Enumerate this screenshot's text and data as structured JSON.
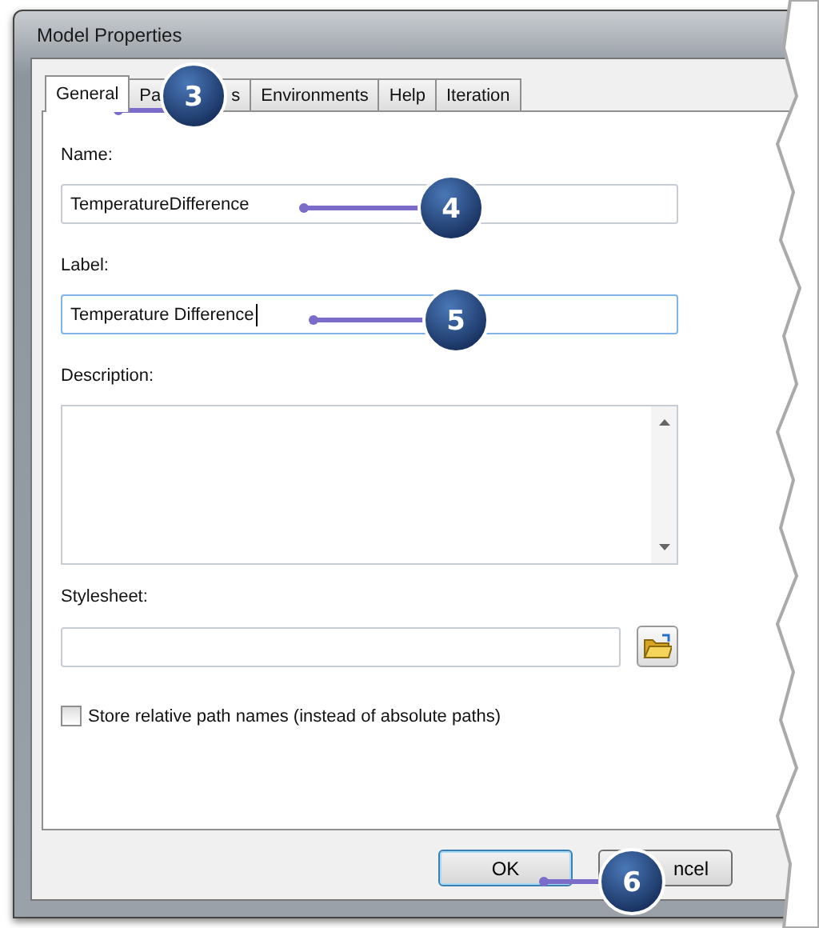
{
  "window": {
    "title": "Model Properties"
  },
  "tabs": [
    {
      "label": "General",
      "selected": true
    },
    {
      "label_start": "Pa",
      "label_end": "s",
      "selected": false
    },
    {
      "label": "Environments",
      "selected": false
    },
    {
      "label": "Help",
      "selected": false
    },
    {
      "label": "Iteration",
      "selected": false
    }
  ],
  "fields": [
    {
      "kind": "text",
      "label": "Name:",
      "value": "TemperatureDifference",
      "focused": false
    },
    {
      "kind": "text",
      "label": "Label:",
      "value": "Temperature Difference",
      "focused": true
    },
    {
      "kind": "textarea",
      "label": "Description:"
    },
    {
      "kind": "file",
      "label": "Stylesheet:"
    }
  ],
  "checkbox": {
    "label": "Store relative path names (instead of absolute paths)",
    "checked": false
  },
  "buttons": [
    {
      "label": "OK",
      "focused": true
    },
    {
      "label": "ncel",
      "focused": false
    }
  ],
  "callouts": [
    {
      "number": "3"
    },
    {
      "number": "4"
    },
    {
      "number": "5"
    },
    {
      "number": "6"
    }
  ]
}
